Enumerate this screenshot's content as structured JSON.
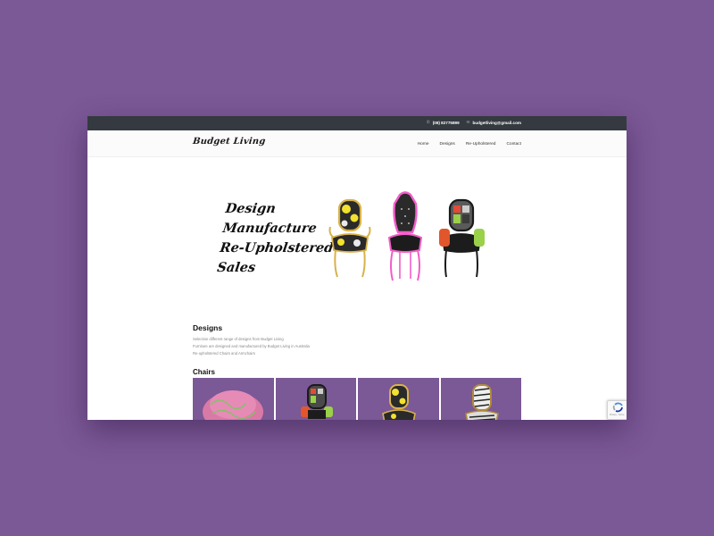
{
  "topbar": {
    "phone": "(08) 82775899",
    "email": "budgetliving@gmail.com",
    "phone_icon": "phone-icon",
    "email_icon": "mail-icon"
  },
  "header": {
    "logo": "Budget Living",
    "nav": [
      "Home",
      "Designs",
      "Re-Upholstered",
      "Contact"
    ]
  },
  "hero": {
    "lines": [
      "Design",
      "Manufacture",
      "Re-Upholstered",
      "Sales"
    ]
  },
  "designs": {
    "title": "Designs",
    "lines": [
      "Selection different range of designs from Budget Living",
      "Furniture are designed and manufactured by Budget Living in Australia",
      "Re-upholstered Chairs and Armchairs"
    ]
  },
  "chairs": {
    "title": "Chairs"
  },
  "recaptcha": {
    "text": "Privacy - Terms"
  },
  "colors": {
    "background": "#7b5896",
    "topbar": "#343a40",
    "tile": "#7b5896"
  }
}
